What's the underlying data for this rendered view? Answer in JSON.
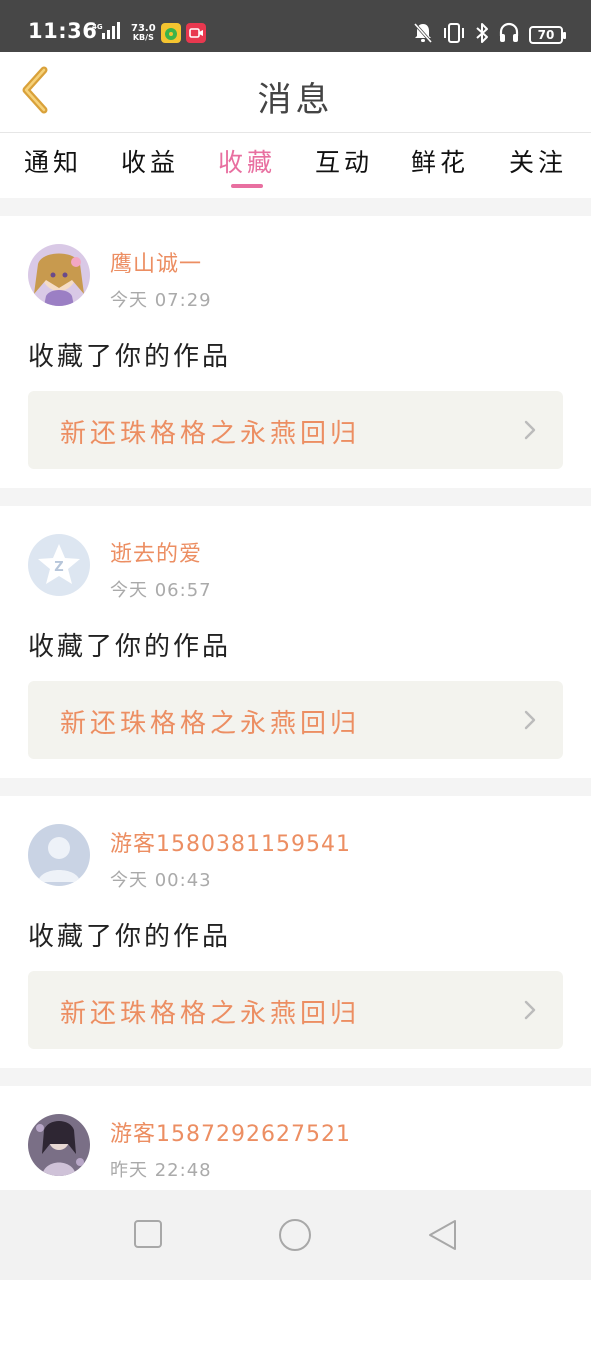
{
  "status_bar": {
    "time": "11:36",
    "network": "4G",
    "speed_value": "73.0",
    "speed_unit": "KB/S",
    "battery": "70",
    "icons": [
      "signal-icon",
      "music-app-icon",
      "recorder-app-icon",
      "mute-icon",
      "vibrate-icon",
      "bluetooth-icon",
      "headphones-icon",
      "battery-icon"
    ]
  },
  "header": {
    "title": "消息",
    "back_icon": "chevron-left-icon"
  },
  "tabs": [
    {
      "label": "通知",
      "active": false
    },
    {
      "label": "收益",
      "active": false
    },
    {
      "label": "收藏",
      "active": true
    },
    {
      "label": "互动",
      "active": false
    },
    {
      "label": "鲜花",
      "active": false
    },
    {
      "label": "关注",
      "active": false
    }
  ],
  "messages": [
    {
      "username": "鹰山诚一",
      "time": "今天 07:29",
      "action": "收藏了你的作品",
      "work_title": "新还珠格格之永燕回归"
    },
    {
      "username": "逝去的爱",
      "time": "今天 06:57",
      "action": "收藏了你的作品",
      "work_title": "新还珠格格之永燕回归"
    },
    {
      "username": "游客1580381159541",
      "time": "今天 00:43",
      "action": "收藏了你的作品",
      "work_title": "新还珠格格之永燕回归"
    },
    {
      "username": "游客1587292627521",
      "time": "昨天 22:48"
    }
  ],
  "colors": {
    "accent": "#e86fa0",
    "name": "#ec8e62",
    "back_arrow": "#d9a13a"
  },
  "nav": {
    "icons": [
      "recent-apps-icon",
      "home-icon",
      "back-icon"
    ]
  }
}
